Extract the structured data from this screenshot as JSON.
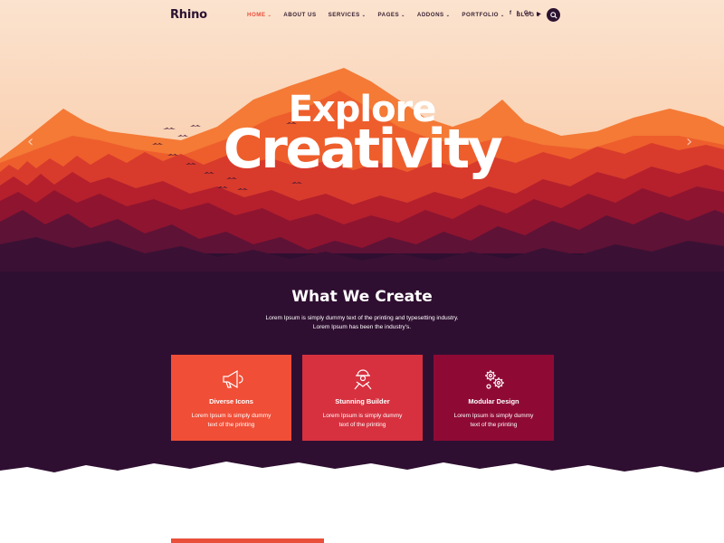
{
  "brand": {
    "logo": "Rhino"
  },
  "nav": {
    "items": [
      {
        "label": "HOME",
        "active": true
      },
      {
        "label": "ABOUT US",
        "active": false
      },
      {
        "label": "SERVICES",
        "active": false
      },
      {
        "label": "PAGES",
        "active": false
      },
      {
        "label": "ADDONS",
        "active": false
      },
      {
        "label": "PORTFOLIO",
        "active": false
      },
      {
        "label": "BLOG",
        "active": false
      }
    ],
    "chevron": "⌄",
    "social": [
      {
        "icon": "facebook-icon",
        "glyph": "f"
      },
      {
        "icon": "twitter-icon",
        "glyph": "t"
      },
      {
        "icon": "google-plus-icon",
        "glyph": "G+"
      },
      {
        "icon": "youtube-icon",
        "glyph": "▶"
      }
    ],
    "search_icon": "search-icon"
  },
  "hero": {
    "line1": "Explore",
    "line2": "Creativity",
    "prev_arrow": "‹",
    "next_arrow": "›"
  },
  "section": {
    "title": "What We Create",
    "desc_line1": "Lorem Ipsum is simply dummy text of the printing and typesetting industry.",
    "desc_line2": "Lorem Ipsum has been the industry's."
  },
  "cards": [
    {
      "title": "Diverse Icons",
      "desc": "Lorem Ipsum is simply dummy text of the printing",
      "color": "#f04e37",
      "icon": "megaphone-icon"
    },
    {
      "title": "Stunning Builder",
      "desc": "Lorem Ipsum is simply dummy text of the printing",
      "color": "#d7313f",
      "icon": "builder-icon"
    },
    {
      "title": "Modular Design",
      "desc": "Lorem Ipsum is simply dummy text of the printing",
      "color": "#8e0a35",
      "icon": "gears-icon"
    }
  ],
  "colors": {
    "accent": "#e94f3b",
    "dark": "#2e1030",
    "sky_top": "#fbe0c9",
    "sky_bottom": "#f9a877"
  }
}
